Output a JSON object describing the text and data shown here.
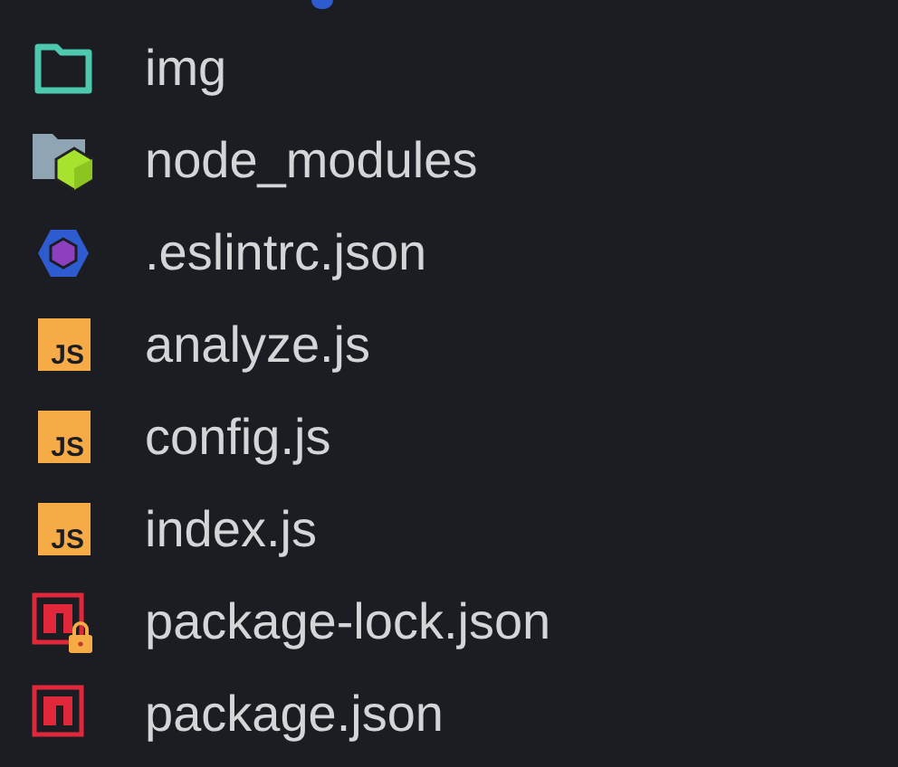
{
  "files": [
    {
      "name": "img",
      "kind": "folder"
    },
    {
      "name": "node_modules",
      "kind": "node-folder"
    },
    {
      "name": ".eslintrc.json",
      "kind": "eslint"
    },
    {
      "name": "analyze.js",
      "kind": "js",
      "icon_text": "JS"
    },
    {
      "name": "config.js",
      "kind": "js",
      "icon_text": "JS"
    },
    {
      "name": "index.js",
      "kind": "js",
      "icon_text": "JS"
    },
    {
      "name": "package-lock.json",
      "kind": "npm-lock"
    },
    {
      "name": "package.json",
      "kind": "npm"
    }
  ]
}
